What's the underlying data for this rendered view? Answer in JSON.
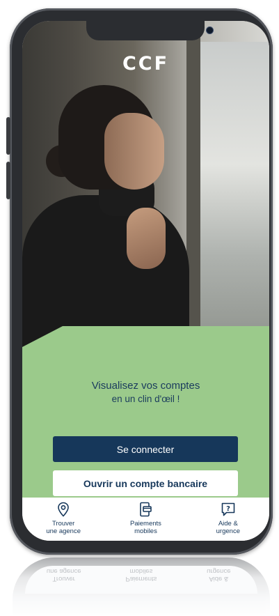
{
  "brand": {
    "logo_text": "CCF"
  },
  "promo": {
    "line1": "Visualisez vos comptes",
    "line2": "en un clin d'œil !"
  },
  "buttons": {
    "login": "Se connecter",
    "open_account": "Ouvrir un compte bancaire"
  },
  "nav": [
    {
      "label": "Trouver\nune agence",
      "icon": "location-pin-icon"
    },
    {
      "label": "Paiements\nmobiles",
      "icon": "mobile-payment-icon"
    },
    {
      "label": "Aide &\nurgence",
      "icon": "help-question-icon"
    }
  ],
  "colors": {
    "primary_navy": "#16375a",
    "panel_green": "#9bca8b",
    "white": "#ffffff"
  }
}
